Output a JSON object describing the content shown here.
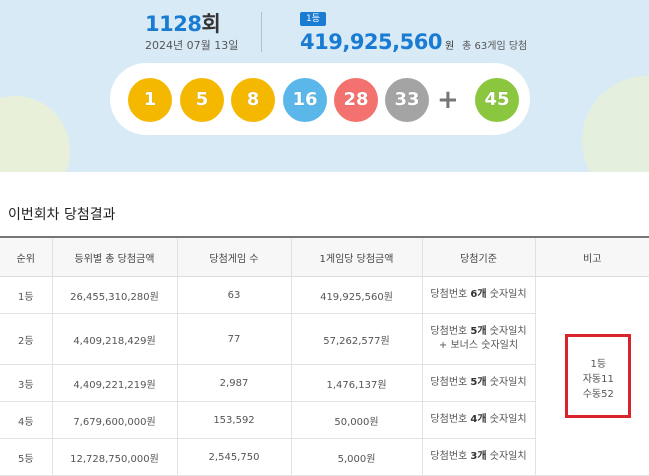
{
  "header": {
    "round_number": "1128",
    "round_suffix": "회",
    "date": "2024년 07월 13일",
    "rank_badge": "1등",
    "first_prize_amount": "419,925,560",
    "first_prize_unit": "원",
    "winner_note": "총 63게임 당첨"
  },
  "balls": [
    {
      "number": "1",
      "color": "#f5b800"
    },
    {
      "number": "5",
      "color": "#f5b800"
    },
    {
      "number": "8",
      "color": "#f5b800"
    },
    {
      "number": "16",
      "color": "#5bb7ea"
    },
    {
      "number": "28",
      "color": "#f37270"
    },
    {
      "number": "33",
      "color": "#a4a4a4"
    }
  ],
  "plus_sign": "+",
  "bonus_ball": {
    "number": "45",
    "color": "#8bc63f"
  },
  "section_title": "이번회차 당첨결과",
  "table": {
    "headers": [
      "순위",
      "등위별 총 당첨금액",
      "당첨게임 수",
      "1게임당 당첨금액",
      "당첨기준",
      "비고"
    ],
    "rows": [
      {
        "rank": "1등",
        "total": "26,455,310,280원",
        "games": "63",
        "per_game": "419,925,560원",
        "std_pre": "당첨번호 ",
        "std_bold": "6개",
        "std_post": " 숫자일치",
        "std2": ""
      },
      {
        "rank": "2등",
        "total": "4,409,218,429원",
        "games": "77",
        "per_game": "57,262,577원",
        "std_pre": "당첨번호 ",
        "std_bold": "5개",
        "std_post": " 숫자일치",
        "std2": "+ 보너스 숫자일치"
      },
      {
        "rank": "3등",
        "total": "4,409,221,219원",
        "games": "2,987",
        "per_game": "1,476,137원",
        "std_pre": "당첨번호 ",
        "std_bold": "5개",
        "std_post": " 숫자일치",
        "std2": ""
      },
      {
        "rank": "4등",
        "total": "7,679,600,000원",
        "games": "153,592",
        "per_game": "50,000원",
        "std_pre": "당첨번호 ",
        "std_bold": "4개",
        "std_post": " 숫자일치",
        "std2": ""
      },
      {
        "rank": "5등",
        "total": "12,728,750,000원",
        "games": "2,545,750",
        "per_game": "5,000원",
        "std_pre": "당첨번호 ",
        "std_bold": "3개",
        "std_post": " 숫자일치",
        "std2": ""
      }
    ],
    "note": {
      "line1": "1등",
      "line2": "자동11",
      "line3": "수동52"
    }
  },
  "colors": {
    "accent": "#1a7bd2",
    "highlight_border": "#d9232d",
    "hero_bg": "#d9eaf7"
  }
}
